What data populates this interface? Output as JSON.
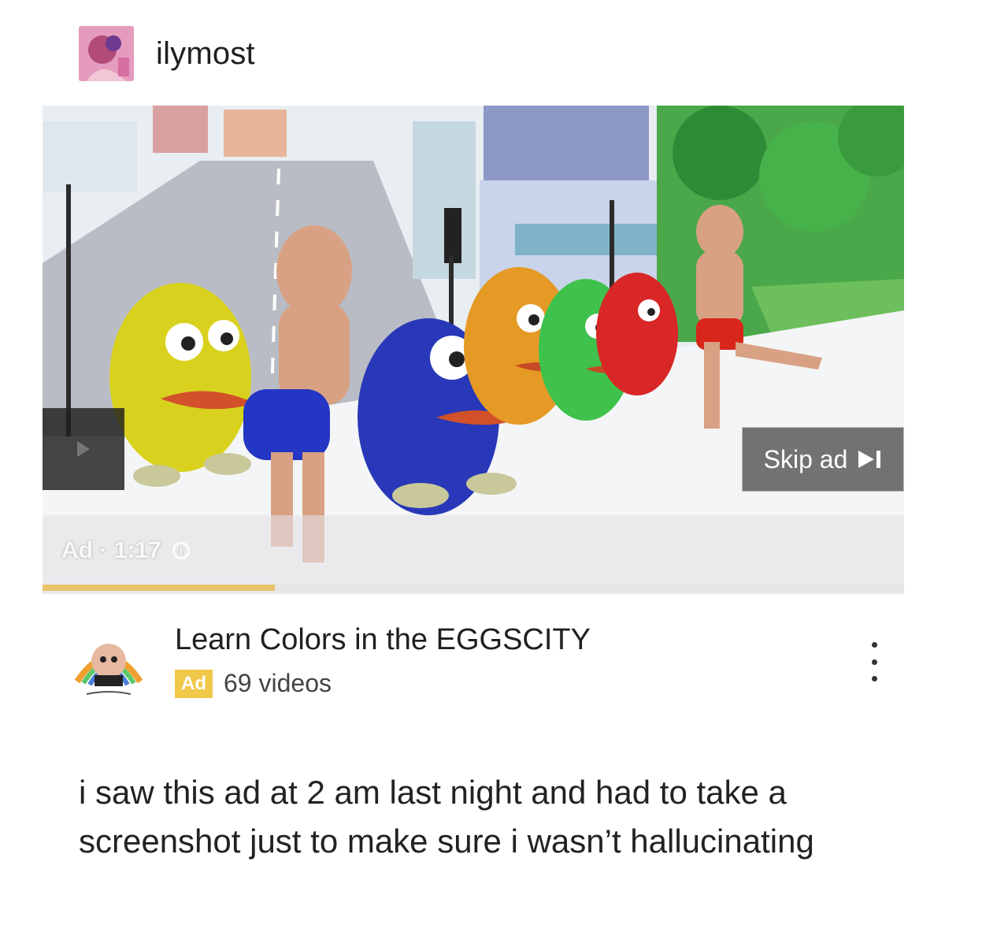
{
  "post": {
    "username": "ilymost",
    "caption": "i saw this ad at 2 am last night and had to take a screenshot just to make sure i wasn’t hallucinating"
  },
  "video": {
    "skip_label": "Skip ad",
    "ad_time": "Ad · 1:17",
    "progress": 0.27
  },
  "channel": {
    "title": "Learn Colors in the EGGSCITY",
    "ad_badge": "Ad",
    "video_count": "69 videos"
  },
  "icons": {
    "skip": "skip-next-icon",
    "info": "info-icon",
    "more": "more-vertical-icon",
    "play": "play-arrow-icon"
  }
}
